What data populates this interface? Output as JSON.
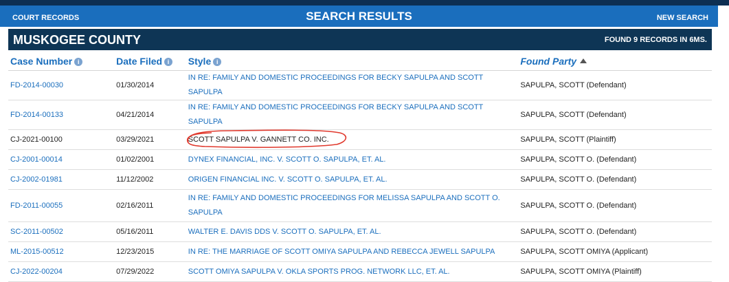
{
  "header": {
    "left_link": "COURT RECORDS",
    "title": "SEARCH RESULTS",
    "right_link": "NEW SEARCH"
  },
  "county": {
    "name": "MUSKOGEE COUNTY",
    "found_text": "FOUND 9 RECORDS IN 6MS."
  },
  "columns": {
    "case_number": "Case Number",
    "date_filed": "Date Filed",
    "style": "Style",
    "found_party": "Found Party"
  },
  "icons": {
    "info": "info-icon",
    "sort": "sort-ascending-icon"
  },
  "colors": {
    "accent": "#1a6ebd",
    "dark_bar": "#0e3555",
    "annotation": "#e0382c"
  },
  "rows": [
    {
      "case": "FD-2014-00030",
      "date": "01/30/2014",
      "style": "IN RE: FAMILY AND DOMESTIC PROCEEDINGS FOR BECKY SAPULPA AND SCOTT SAPULPA",
      "party": "SAPULPA, SCOTT (Defendant)"
    },
    {
      "case": "FD-2014-00133",
      "date": "04/21/2014",
      "style": "IN RE: FAMILY AND DOMESTIC PROCEEDINGS FOR BECKY SAPULPA AND SCOTT SAPULPA",
      "party": "SAPULPA, SCOTT (Defendant)"
    },
    {
      "case": "CJ-2021-00100",
      "date": "03/29/2021",
      "style": "SCOTT SAPULPA V. GANNETT CO. INC.",
      "party": "SAPULPA, SCOTT (Plaintiff)"
    },
    {
      "case": "CJ-2001-00014",
      "date": "01/02/2001",
      "style": "DYNEX FINANCIAL, INC. V. SCOTT O. SAPULPA, ET. AL.",
      "party": "SAPULPA, SCOTT O. (Defendant)"
    },
    {
      "case": "CJ-2002-01981",
      "date": "11/12/2002",
      "style": "ORIGEN FINANCIAL INC. V. SCOTT O. SAPULPA, ET. AL.",
      "party": "SAPULPA, SCOTT O. (Defendant)"
    },
    {
      "case": "FD-2011-00055",
      "date": "02/16/2011",
      "style": "IN RE: FAMILY AND DOMESTIC PROCEEDINGS FOR MELISSA SAPULPA AND SCOTT O. SAPULPA",
      "party": "SAPULPA, SCOTT O. (Defendant)"
    },
    {
      "case": "SC-2011-00502",
      "date": "05/16/2011",
      "style": "WALTER E. DAVIS DDS V. SCOTT O. SAPULPA, ET. AL.",
      "party": "SAPULPA, SCOTT O. (Defendant)"
    },
    {
      "case": "ML-2015-00512",
      "date": "12/23/2015",
      "style": "IN RE: THE MARRIAGE OF SCOTT OMIYA SAPULPA AND REBECCA JEWELL SAPULPA",
      "party": "SAPULPA, SCOTT OMIYA (Applicant)"
    },
    {
      "case": "CJ-2022-00204",
      "date": "07/29/2022",
      "style": "SCOTT OMIYA SAPULPA V. OKLA SPORTS PROG. NETWORK LLC, ET. AL.",
      "party": "SAPULPA, SCOTT OMIYA (Plaintiff)"
    }
  ]
}
